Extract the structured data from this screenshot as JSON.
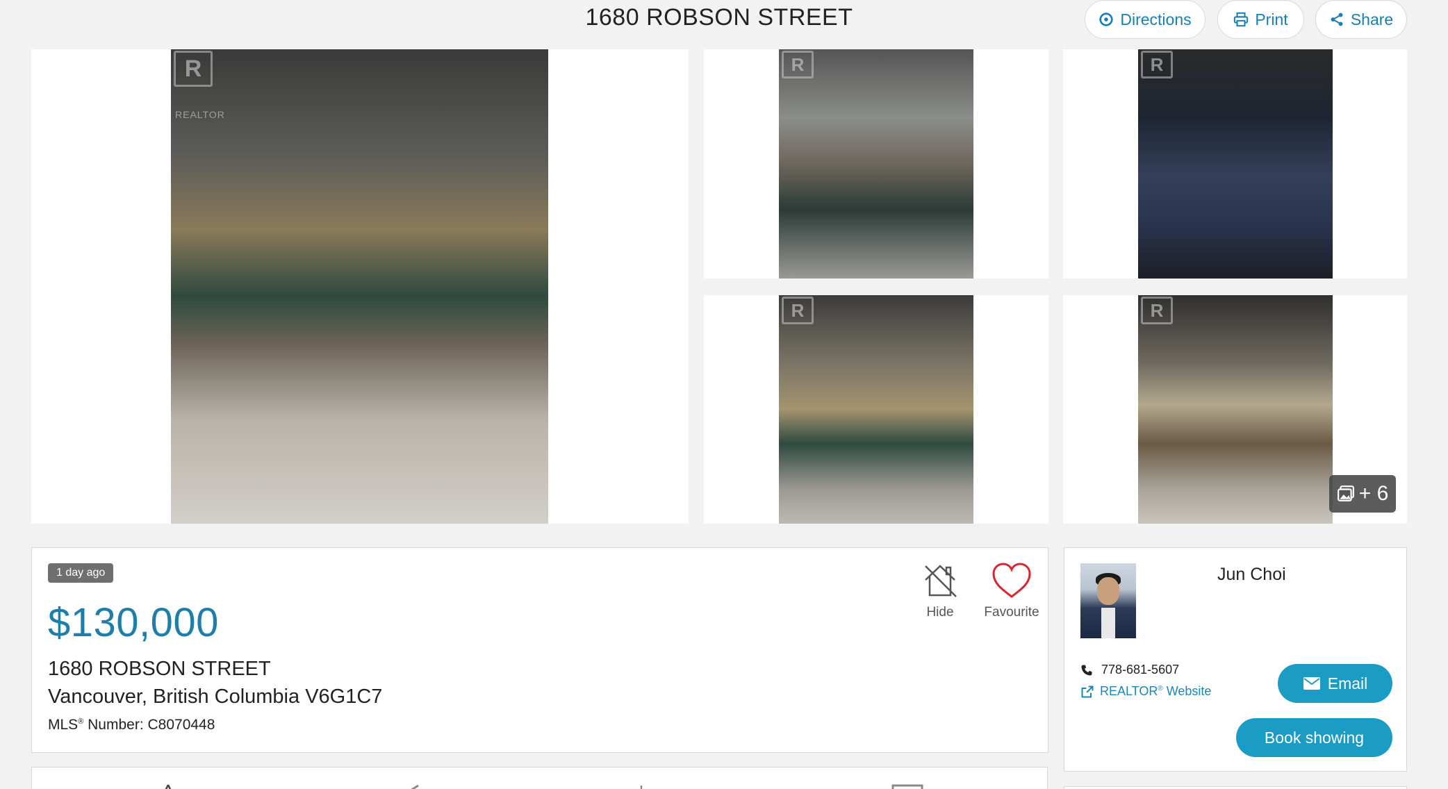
{
  "header": {
    "title": "1680 ROBSON STREET",
    "directions_label": "Directions",
    "print_label": "Print",
    "share_label": "Share"
  },
  "gallery": {
    "watermark_text": "REALTOR",
    "more_count": "+ 6"
  },
  "listing": {
    "age": "1 day ago",
    "price": "$130,000",
    "address_line1": "1680 ROBSON STREET",
    "address_line2": "Vancouver, British Columbia V6G1C7",
    "mls_label": "MLS",
    "mls_rest": " Number: C8070448",
    "hide_label": "Hide",
    "favourite_label": "Favourite"
  },
  "agent": {
    "name": "Jun Choi",
    "phone": "778-681-5607",
    "website_label": "REALTOR",
    "website_rest": " Website",
    "email_label": "Email",
    "book_label": "Book showing"
  },
  "colors": {
    "accent": "#1a9cc4",
    "price": "#1f7ea7",
    "favourite": "#d9252f"
  }
}
